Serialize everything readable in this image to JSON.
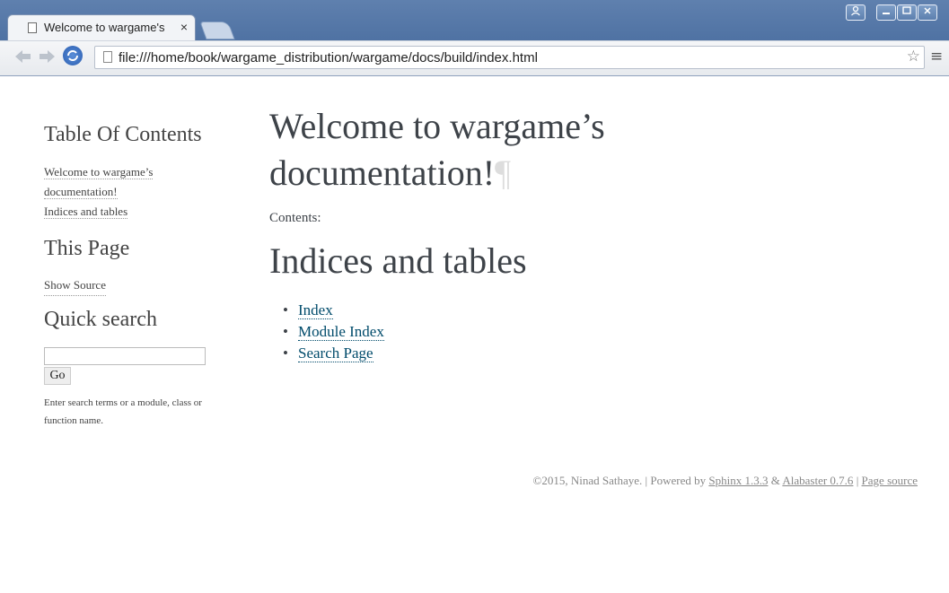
{
  "browser": {
    "tab_title": "Welcome to wargame's",
    "tab_close": "×",
    "url": "file:///home/book/wargame_distribution/wargame/docs/build/index.html",
    "icons": [
      "page-icon",
      "back-arrow-icon",
      "forward-arrow-icon",
      "reload-icon",
      "star-icon",
      "menu-icon",
      "profile-icon",
      "minimize-icon",
      "maximize-icon",
      "close-icon"
    ]
  },
  "sidebar": {
    "toc_heading": "Table Of Contents",
    "toc_items": [
      "Welcome to wargame’s documentation!",
      "Indices and tables"
    ],
    "this_page_heading": "This Page",
    "show_source": "Show Source",
    "search_heading": "Quick search",
    "search_value": "",
    "go_label": "Go",
    "search_hint": "Enter search terms or a module, class or function name."
  },
  "main": {
    "title": "Welcome to wargame’s documentation!",
    "pilcrow": "¶",
    "contents_label": "Contents:",
    "indices_heading": "Indices and tables",
    "links": [
      "Index",
      "Module Index",
      "Search Page"
    ]
  },
  "footer": {
    "copyright": "©2015, Ninad Sathaye. | Powered by ",
    "sphinx": "Sphinx 1.3.3",
    "amp": " & ",
    "alabaster": "Alabaster 0.7.6",
    "sep": " | ",
    "page_source": "Page source"
  }
}
